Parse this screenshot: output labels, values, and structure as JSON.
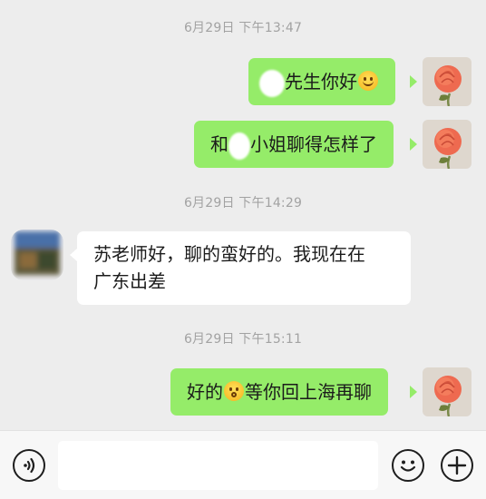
{
  "messages": [
    {
      "type": "timestamp",
      "text": "6月29日 下午13:47"
    },
    {
      "type": "outgoing",
      "text_after": "先生你好"
    },
    {
      "type": "outgoing",
      "text_before": "和",
      "text_after": "小姐聊得怎样了"
    },
    {
      "type": "timestamp",
      "text": "6月29日 下午14:29"
    },
    {
      "type": "incoming",
      "line1": "苏老师好，聊的蛮好的。我现在在",
      "line2": "广东出差"
    },
    {
      "type": "timestamp",
      "text": "6月29日 下午15:11"
    },
    {
      "type": "outgoing",
      "text_before": "好的",
      "text_after": "等你回上海再聊"
    }
  ],
  "toolbar": {
    "voice_icon": "voice-icon",
    "emoji_icon": "emoji-icon",
    "plus_icon": "plus-icon",
    "input_value": ""
  },
  "colors": {
    "background": "#ededed",
    "outgoing_bubble": "#95ec69",
    "incoming_bubble": "#ffffff",
    "timestamp": "#a2a2a2"
  }
}
